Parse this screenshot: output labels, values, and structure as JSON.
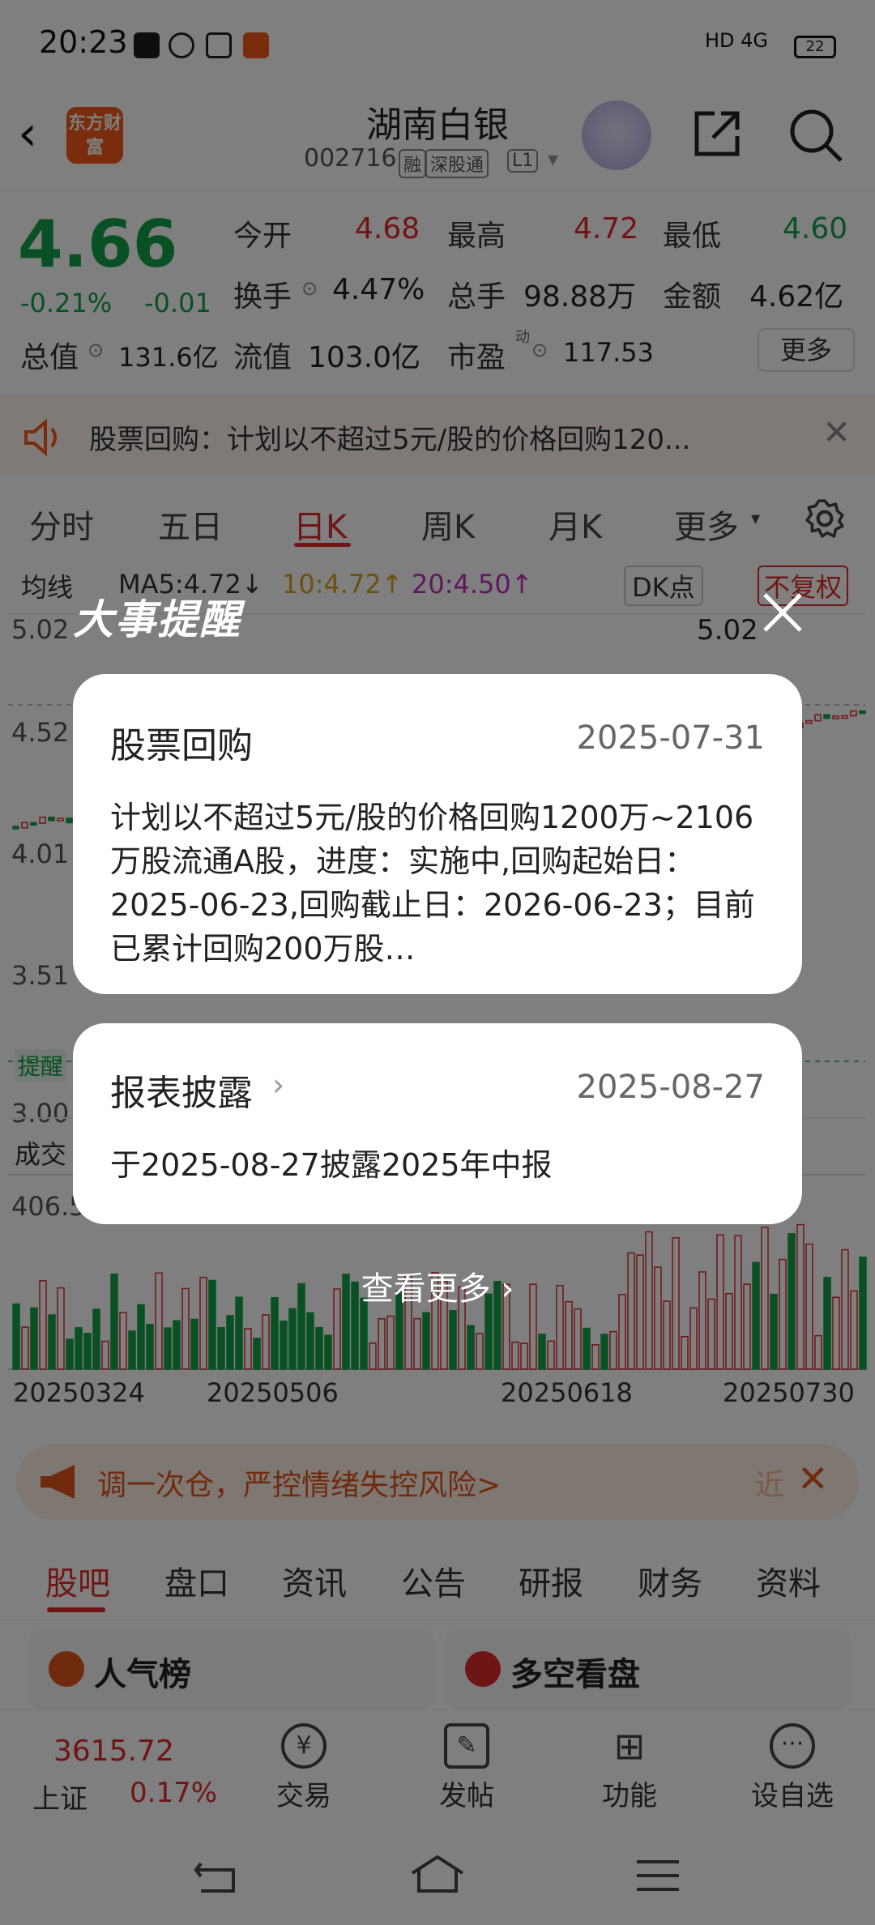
{
  "status_bar": {
    "time": "20:23",
    "network": "HD 4G",
    "battery": "22"
  },
  "header": {
    "logo_text": "东方财富",
    "stock_name": "湖南白银",
    "stock_code": "002716",
    "tags": [
      "融",
      "深股通",
      "L1"
    ]
  },
  "quote": {
    "price": "4.66",
    "change_pct": "-0.21%",
    "change": "-0.01",
    "open_label": "今开",
    "open": "4.68",
    "high_label": "最高",
    "high": "4.72",
    "low_label": "最低",
    "low": "4.60",
    "turnover_label": "换手",
    "turnover": "4.47%",
    "volume_label": "总手",
    "volume": "98.88万",
    "amount_label": "金额",
    "amount": "4.62亿",
    "mktcap_label": "总值",
    "mktcap": "131.6亿",
    "float_label": "流值",
    "float": "103.0亿",
    "pe_label": "市盈",
    "pe_sup": "动",
    "pe": "117.53",
    "more_label": "更多"
  },
  "notice": {
    "text": "股票回购：计划以不超过5元/股的价格回购120..."
  },
  "kline_tabs": {
    "items": [
      "分时",
      "五日",
      "日K",
      "周K",
      "月K",
      "更多"
    ],
    "active": "日K"
  },
  "chart_bar": {
    "ma_select": "均线",
    "ma5": "MA5:4.72↓",
    "ma10": "10:4.72↑",
    "ma20": "20:4.50↑",
    "dk": "DK点",
    "fq": "不复权"
  },
  "chart_data": {
    "type": "candlestick",
    "price_ticks": [
      "5.02",
      "4.52",
      "4.01",
      "3.51",
      "3.00"
    ],
    "max_label": "5.02",
    "volume_label": "成交",
    "volume_tick": "406.5",
    "dates": [
      "20250324",
      "20250506",
      "20250618",
      "20250730"
    ],
    "remind_label": "提醒"
  },
  "overlay": {
    "title": "大事提醒",
    "cards": [
      {
        "title": "股票回购",
        "date": "2025-07-31",
        "body": "计划以不超过5元/股的价格回购1200万~2106万股流通A股，进度：实施中,回购起始日：2025-06-23,回购截止日：2026-06-23；目前已累计回购200万股…"
      },
      {
        "title": "报表披露",
        "date": "2025-08-27",
        "body": "于2025-08-27披露2025年中报"
      }
    ],
    "see_more": "查看更多"
  },
  "banner": {
    "text": "调一次仓，严控情绪失控风险>",
    "side": "近"
  },
  "content_tabs": {
    "items": [
      "股吧",
      "盘口",
      "资讯",
      "公告",
      "研报",
      "财务",
      "资料"
    ],
    "active": "股吧"
  },
  "mini_cards": [
    "人气榜",
    "多空看盘"
  ],
  "bottom_nav": {
    "index_value": "3615.72",
    "index_name": "上证",
    "index_change": "0.17%",
    "items": [
      "交易",
      "发帖",
      "功能",
      "设自选"
    ]
  },
  "colors": {
    "up": "#e02b2b",
    "down": "#13a048",
    "accent": "#f25a1b"
  }
}
